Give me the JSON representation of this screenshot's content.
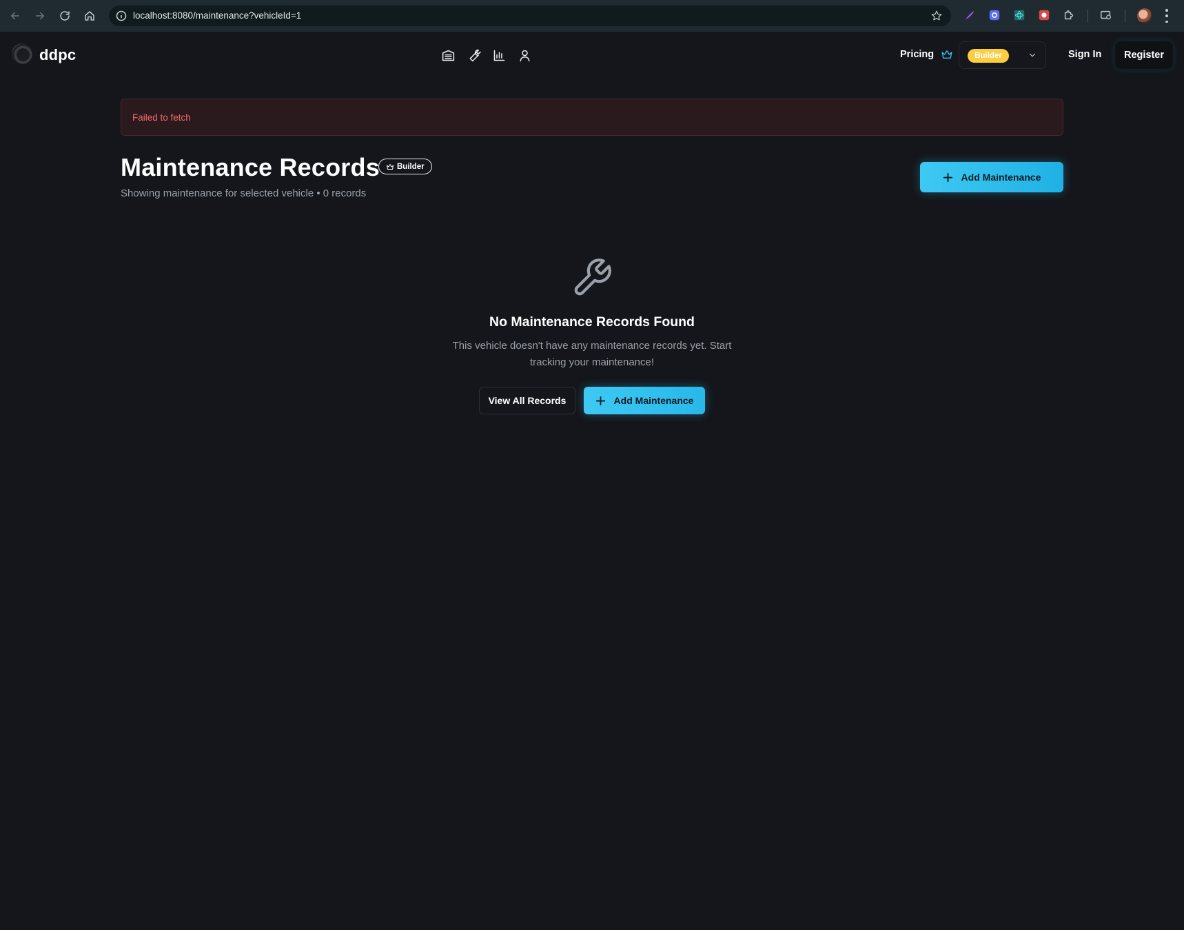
{
  "browser": {
    "url": "localhost:8080/maintenance?vehicleId=1"
  },
  "header": {
    "brand": "ddpc",
    "nav_icons": [
      "garage-icon",
      "wrench-icon",
      "chart-icon",
      "user-icon"
    ],
    "pricing_label": "Pricing",
    "plan_label": "Builder",
    "sign_in_label": "Sign In",
    "register_label": "Register"
  },
  "error": {
    "message": "Failed to fetch"
  },
  "page": {
    "title": "Maintenance Records",
    "badge_label": "Builder",
    "subtitle": "Showing maintenance for selected vehicle • 0 records",
    "add_button_label": "Add Maintenance"
  },
  "empty_state": {
    "icon": "wrench-icon",
    "title": "No Maintenance Records Found",
    "description": "This vehicle doesn't have any maintenance records yet. Start tracking your maintenance!",
    "view_all_label": "View All Records",
    "add_label": "Add Maintenance"
  },
  "colors": {
    "background": "#14161b",
    "accent": "#38c5f0",
    "plan_badge": "#fbcd3f",
    "error_text": "#f26a6a",
    "error_bg": "#2a1a1e"
  }
}
